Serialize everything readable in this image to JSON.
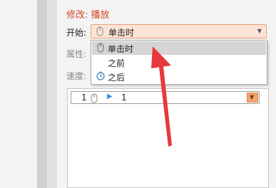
{
  "pane": {
    "title": "修改: 播放"
  },
  "fields": {
    "start_label": "开始:",
    "property_label": "属性:",
    "speed_label": "速度:"
  },
  "start_select": {
    "value": "单击时"
  },
  "dropdown": {
    "items": [
      {
        "label": "单击时",
        "icon": "mouse-icon",
        "selected": true
      },
      {
        "label": "之前",
        "icon": "",
        "selected": false
      },
      {
        "label": "之后",
        "icon": "clock-icon",
        "selected": false
      }
    ]
  },
  "animation_list": {
    "rows": [
      {
        "index": "1",
        "trigger_icon": "mouse-icon",
        "effect_icon": "play-icon",
        "name": "1"
      }
    ]
  },
  "annotation": {
    "color": "#e8383d"
  },
  "colors": {
    "accent": "#d24726",
    "select_bg": "#fbe3d6"
  }
}
